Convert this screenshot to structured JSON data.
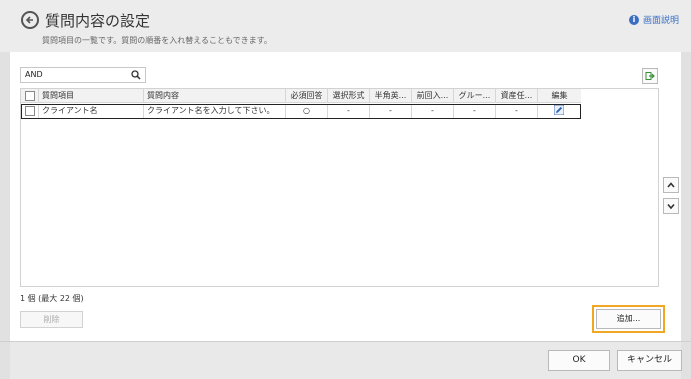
{
  "header": {
    "title": "質問内容の設定",
    "description": "質問項目の一覧です。質問の順番を入れ替えることもできます。",
    "help_label": "画面説明"
  },
  "search": {
    "value": "AND"
  },
  "grid": {
    "columns": [
      "質問項目",
      "質問内容",
      "必須回答",
      "選択形式",
      "半角英...",
      "前回入...",
      "グルー...",
      "資産任...",
      "編集"
    ],
    "rows": [
      {
        "item": "クライアント名",
        "content": "クライアント名を入力して下さい。",
        "required": "○",
        "select_format": "-",
        "half_width": "-",
        "previous": "-",
        "group": "-",
        "asset": "-"
      }
    ]
  },
  "footer": {
    "count_text": "1 個 (最大 22 個)",
    "delete_label": "削除",
    "add_label": "追加...",
    "ok_label": "OK",
    "cancel_label": "キャンセル"
  },
  "icons": {
    "back": "back-arrow-icon",
    "help": "info-icon",
    "search": "search-icon",
    "export": "export-icon",
    "edit": "pencil-icon",
    "scroll_up": "chevron-up-icon",
    "scroll_down": "chevron-down-icon"
  },
  "colors": {
    "accent": "#3a6fc4",
    "highlight": "#f0a723"
  }
}
